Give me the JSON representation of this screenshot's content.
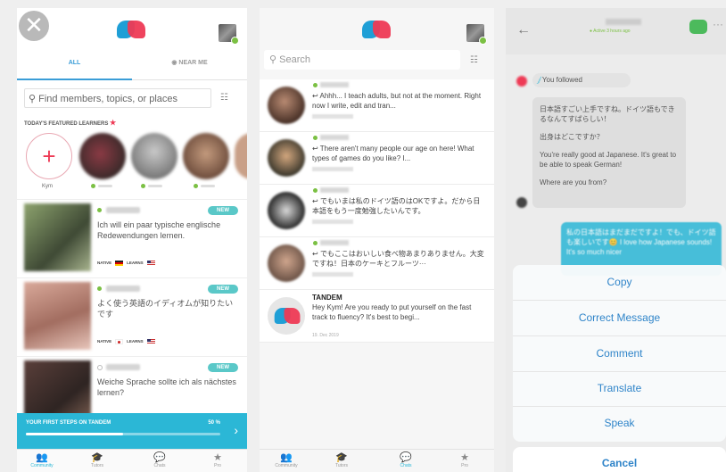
{
  "screen1": {
    "tabs": [
      "ALL",
      "NEAR ME"
    ],
    "search_placeholder": "Find members, topics, or places",
    "featured_title": "TODAY'S FEATURED LEARNERS",
    "add_label": "Kym",
    "members": [
      {
        "badge": "NEW",
        "message": "Ich will ein paar typische englische Redewendungen lernen.",
        "native_label": "NATIVE",
        "learns_label": "LEARNS",
        "native_flag": "de",
        "learns_flag": "us"
      },
      {
        "badge": "NEW",
        "message": "よく使う英語のイディオムが知りたいです",
        "native_label": "NATIVE",
        "learns_label": "LEARNS",
        "native_flag": "jp",
        "learns_flag": "us"
      },
      {
        "badge": "NEW",
        "message": "Weiche Sprache sollte ich als nächstes lernen?"
      }
    ],
    "steps": {
      "title": "YOUR FIRST STEPS ON TANDEM",
      "percent_label": "50 %",
      "progress": 0.5
    },
    "tabbar": [
      {
        "label": "Community",
        "icon": "community-icon"
      },
      {
        "label": "Tutors",
        "icon": "graduation-cap-icon"
      },
      {
        "label": "Chats",
        "icon": "chat-bubble-icon"
      },
      {
        "label": "Pro",
        "icon": "star-icon"
      }
    ]
  },
  "screen2": {
    "search_placeholder": "Search",
    "chats": [
      {
        "message": "Ahhh... I teach adults, but not at the moment. Right now I write, edit and tran..."
      },
      {
        "message": "There aren't many people our age on here! What types of games do you like? I..."
      },
      {
        "message": "でもいまは私のドイツ語のはOKですよ。だから日本語をもう一度勉強したいんです。"
      },
      {
        "message": "でもここはおいしい食べ物あまりありません。大変ですね！日本のケーキとフルーツ···"
      },
      {
        "name": "TANDEM",
        "message": "Hey Kym! Are you ready to put yourself on the fast track to fluency? It's best to begi...",
        "time": "19. Dec 2019"
      }
    ],
    "tabbar": [
      {
        "label": "Community",
        "icon": "community-icon"
      },
      {
        "label": "Tutors",
        "icon": "graduation-cap-icon"
      },
      {
        "label": "Chats",
        "icon": "chat-bubble-icon"
      },
      {
        "label": "Pro",
        "icon": "star-icon"
      }
    ]
  },
  "screen3": {
    "status": "● Active 3 hours ago",
    "followed_text": "You followed",
    "received_lines": [
      "日本語すごい上手ですね。ドイツ語もできるなんてすばらしい！",
      "出身はどこですか？",
      "You're really good at Japanese. It's great to be able to speak German!",
      "Where are you from?"
    ],
    "sent_text": "私の日本語はまだまだですよ！でも、ドイツ語も楽しいです😊 I love how Japanese sounds! It's so much nicer",
    "actions": [
      "Copy",
      "Correct Message",
      "Comment",
      "Translate",
      "Speak"
    ],
    "cancel_label": "Cancel"
  },
  "colors": {
    "accent": "#2bb7d6",
    "brand_red": "#ee3a55",
    "brand_blue": "#1f9fd6",
    "online": "#7bc043",
    "action_text": "#2f84c9"
  }
}
